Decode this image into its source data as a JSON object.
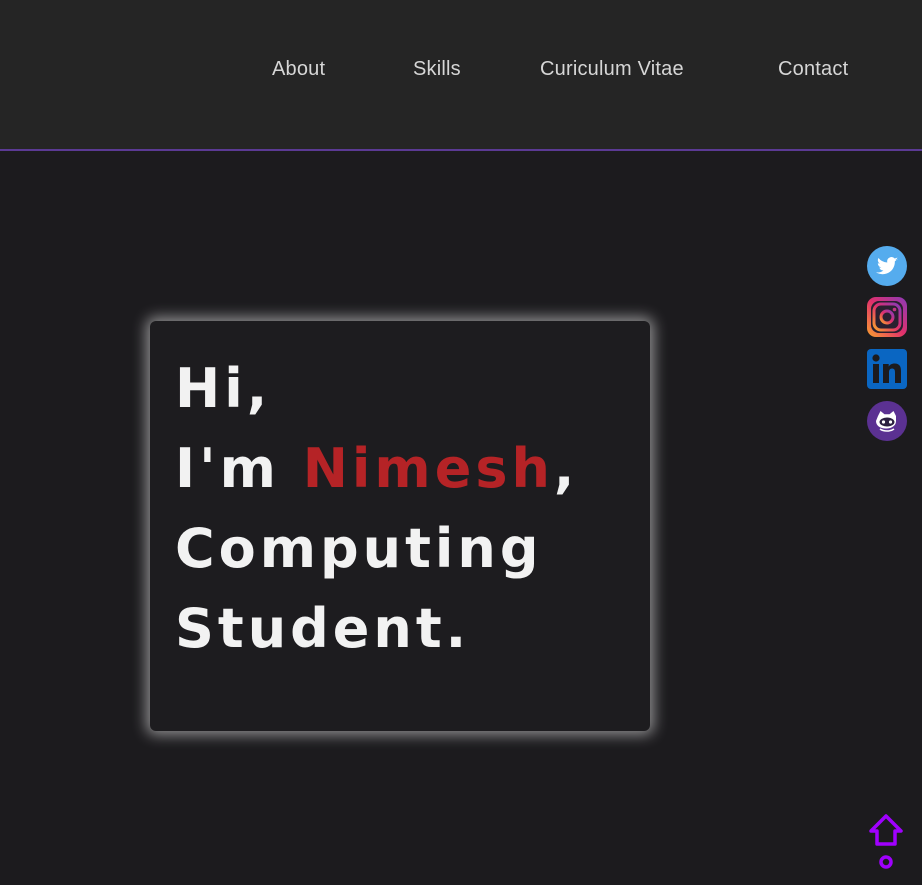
{
  "nav": {
    "items": [
      {
        "label": "About"
      },
      {
        "label": "Skills"
      },
      {
        "label": "Curiculum Vitae"
      },
      {
        "label": "Contact"
      }
    ]
  },
  "hero": {
    "line1": "Hi,",
    "line2_prefix": "I'm",
    "name": "Nimesh",
    "line2_suffix": ",",
    "line3": "Computing",
    "line4": "Student."
  },
  "social": {
    "icons": [
      "twitter-icon",
      "instagram-icon",
      "linkedin-icon",
      "github-icon"
    ]
  },
  "scroll_top": {
    "icon": "arrow-up-icon"
  },
  "colors": {
    "background": "#1c1b1e",
    "header": "#252525",
    "header_border": "#5b3a94",
    "name_accent": "#b52326",
    "scroll_accent": "#a000ff"
  }
}
